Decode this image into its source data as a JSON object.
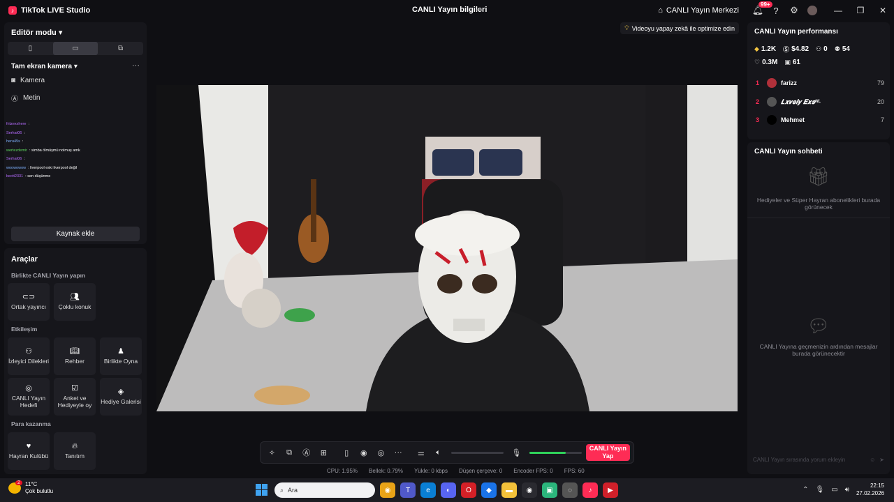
{
  "app": {
    "title": "TikTok LIVE Studio",
    "center_title": "CANLI Yayın bilgileri",
    "live_center": "CANLI Yayın Merkezi",
    "notif_badge": "99+"
  },
  "left": {
    "editor_mode": "Editör modu",
    "full_camera": "Tam ekran kamera",
    "sources": [
      "Kamera",
      "Metin"
    ],
    "add_source": "Kaynak ekle",
    "chat_preview": [
      {
        "user": "fritzexxhere",
        "text": ":"
      },
      {
        "user": "Serhat06",
        "text": ":"
      },
      {
        "user": "heru45s",
        "text": ":"
      },
      {
        "user": "wertezdemir",
        "text": ": simba ölmüşmü nolmuş amk"
      },
      {
        "user": "Serhat06",
        "text": ":"
      },
      {
        "user": "woowowow",
        "text": ": liverpool eski liverpool değil"
      },
      {
        "user": "bectt2331",
        "text": ": sen düşünme"
      }
    ]
  },
  "tools": {
    "title": "Araçlar",
    "collab_title": "Birlikte CANLI Yayın yapın",
    "collab": [
      "Ortak yayıncı",
      "Çoklu konuk"
    ],
    "interaction_title": "Etkileşim",
    "interaction": [
      "İzleyici Dilekleri",
      "Rehber",
      "Birlikte Oyna",
      "CANLI Yayın Hedefi",
      "Anket ve Hediyeyle oy",
      "Hediye Galerisi"
    ],
    "monetize_title": "Para kazanma",
    "monetize": [
      "Hayran Kulübü",
      "Tanıtım"
    ]
  },
  "stage": {
    "ai_hint": "Videoyu yapay zekâ ile optimize edin"
  },
  "controls": {
    "go_live": "CANLI Yayın Yap",
    "mic_level": 0.7
  },
  "stats": [
    "CPU: 1.95%",
    "Bellek: 0.79%",
    "Yükle: 0 kbps",
    "Düşen çerçeve: 0",
    "Encoder FPS: 0",
    "FPS: 60"
  ],
  "performance": {
    "title": "CANLI Yayın performansı",
    "kpis_row1": [
      "1.2K",
      "$4.82",
      "0",
      "54"
    ],
    "kpis_row2": [
      "0.3M",
      "61"
    ],
    "ranking": [
      {
        "rank": "1",
        "name": "farizz",
        "score": "79"
      },
      {
        "rank": "2",
        "name": "𝑳𝒙𝒗𝒆𝒍𝒚 𝑬𝒙𝒔ᴺᴸ",
        "score": "20"
      },
      {
        "rank": "3",
        "name": "Mehmet",
        "score": "7"
      }
    ]
  },
  "chat": {
    "title": "CANLI Yayın sohbeti",
    "gifts_empty": "Hediyeler ve Süper Hayran abonelikleri burada görünecek",
    "messages_empty": "CANLI Yayına geçmenizin ardından mesajlar burada görünecektir",
    "input_placeholder": "CANLI Yayın sırasında yorum ekleyin"
  },
  "taskbar": {
    "weather_temp": "11°C",
    "weather_desc": "Çok bulutlu",
    "weather_badge": "2",
    "search_placeholder": "Ara",
    "time": "22:15",
    "date": "27.02.2026"
  }
}
